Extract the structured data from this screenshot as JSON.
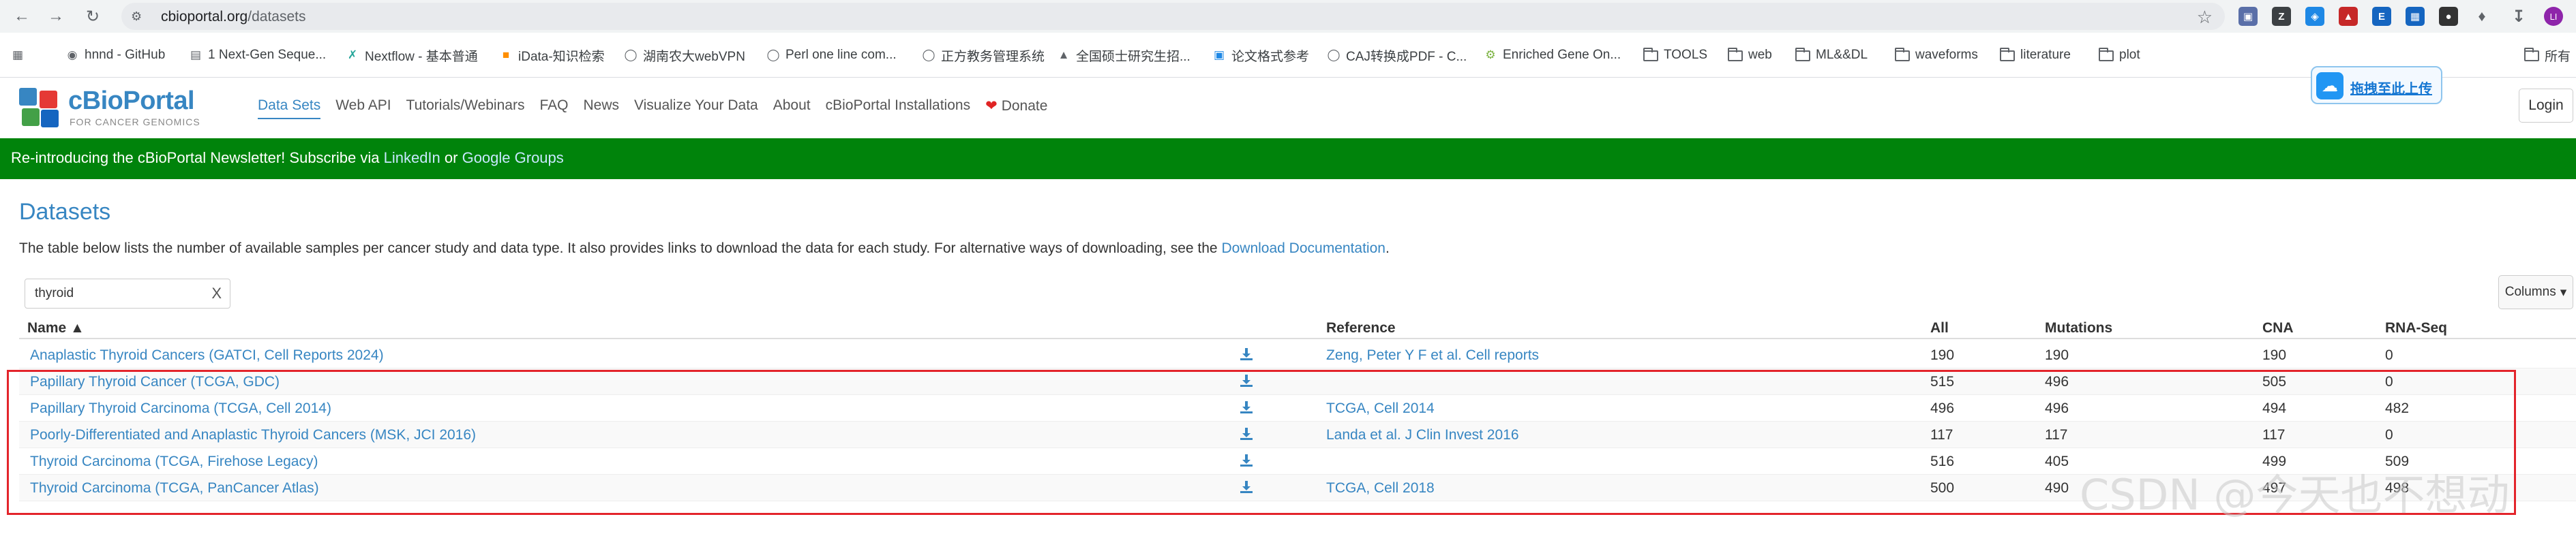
{
  "browser": {
    "url_host": "cbioportal.org",
    "url_path": "/datasets",
    "bookmarks": [
      {
        "label": "hnnd - GitHub",
        "icon": "github-icon"
      },
      {
        "label": "1 Next-Gen Seque...",
        "icon": "doc-icon"
      },
      {
        "label": "Nextflow - 基本普通",
        "icon": "nextflow-icon"
      },
      {
        "label": "iData-知识检索",
        "icon": "idata-icon"
      },
      {
        "label": "湖南农大webVPN",
        "icon": "globe-icon"
      },
      {
        "label": "Perl one line com...",
        "icon": "globe-icon"
      },
      {
        "label": "正方教务管理系统",
        "icon": "globe-icon"
      },
      {
        "label": "全国硕士研究生招...",
        "icon": "graduation-icon"
      },
      {
        "label": "论文格式参考",
        "icon": "wps-icon"
      },
      {
        "label": "CAJ转换成PDF - C...",
        "icon": "globe-icon"
      },
      {
        "label": "Enriched Gene On...",
        "icon": "gear-icon"
      },
      {
        "label": "TOOLS",
        "icon": "folder-icon"
      },
      {
        "label": "web",
        "icon": "folder-icon"
      },
      {
        "label": "ML&&DL",
        "icon": "folder-icon"
      },
      {
        "label": "waveforms",
        "icon": "folder-icon"
      },
      {
        "label": "literature",
        "icon": "folder-icon"
      },
      {
        "label": "plot",
        "icon": "folder-icon"
      },
      {
        "label": "所有",
        "icon": "folder-icon"
      }
    ],
    "profile_initials": "LI"
  },
  "header": {
    "logo_title": "cBioPortal",
    "logo_subtitle": "FOR CANCER GENOMICS",
    "nav": [
      "Data Sets",
      "Web API",
      "Tutorials/Webinars",
      "FAQ",
      "News",
      "Visualize Your Data",
      "About",
      "cBioPortal Installations",
      "Donate"
    ],
    "upload_label": "拖拽至此上传",
    "login_label": "Login"
  },
  "banner": {
    "prefix": "Re-introducing the cBioPortal Newsletter! Subscribe via ",
    "link1": "LinkedIn",
    "middle": " or ",
    "link2": "Google Groups"
  },
  "main": {
    "title": "Datasets",
    "intro_text": "The table below lists the number of available samples per cancer study and data type. It also provides links to download the data for each study. For alternative ways of downloading, see the ",
    "intro_link": "Download Documentation",
    "intro_end": ".",
    "filter_value": "thyroid",
    "filter_clear": "X",
    "columns_label": "Columns"
  },
  "table": {
    "headers": {
      "name": "Name ▲",
      "reference": "Reference",
      "all": "All",
      "mutations": "Mutations",
      "cna": "CNA",
      "rnaseq": "RNA-Seq"
    },
    "rows": [
      {
        "name": "Anaplastic Thyroid Cancers (GATCI, Cell Reports 2024)",
        "reference": "Zeng, Peter Y F et al. Cell reports",
        "all": "190",
        "mutations": "190",
        "cna": "190",
        "rnaseq": "0"
      },
      {
        "name": "Papillary Thyroid Cancer (TCGA, GDC)",
        "reference": "",
        "all": "515",
        "mutations": "496",
        "cna": "505",
        "rnaseq": "0"
      },
      {
        "name": "Papillary Thyroid Carcinoma (TCGA, Cell 2014)",
        "reference": "TCGA, Cell 2014",
        "all": "496",
        "mutations": "496",
        "cna": "494",
        "rnaseq": "482"
      },
      {
        "name": "Poorly-Differentiated and Anaplastic Thyroid Cancers (MSK, JCI 2016)",
        "reference": "Landa et al. J Clin Invest 2016",
        "all": "117",
        "mutations": "117",
        "cna": "117",
        "rnaseq": "0"
      },
      {
        "name": "Thyroid Carcinoma (TCGA, Firehose Legacy)",
        "reference": "",
        "all": "516",
        "mutations": "405",
        "cna": "499",
        "rnaseq": "509"
      },
      {
        "name": "Thyroid Carcinoma (TCGA, PanCancer Atlas)",
        "reference": "TCGA, Cell 2018",
        "all": "500",
        "mutations": "490",
        "cna": "497",
        "rnaseq": "498"
      }
    ]
  },
  "watermark": "CSDN @今天也不想动",
  "colors": {
    "brand": "#3786c2",
    "banner": "#00830b",
    "highlight": "#e3242b"
  }
}
